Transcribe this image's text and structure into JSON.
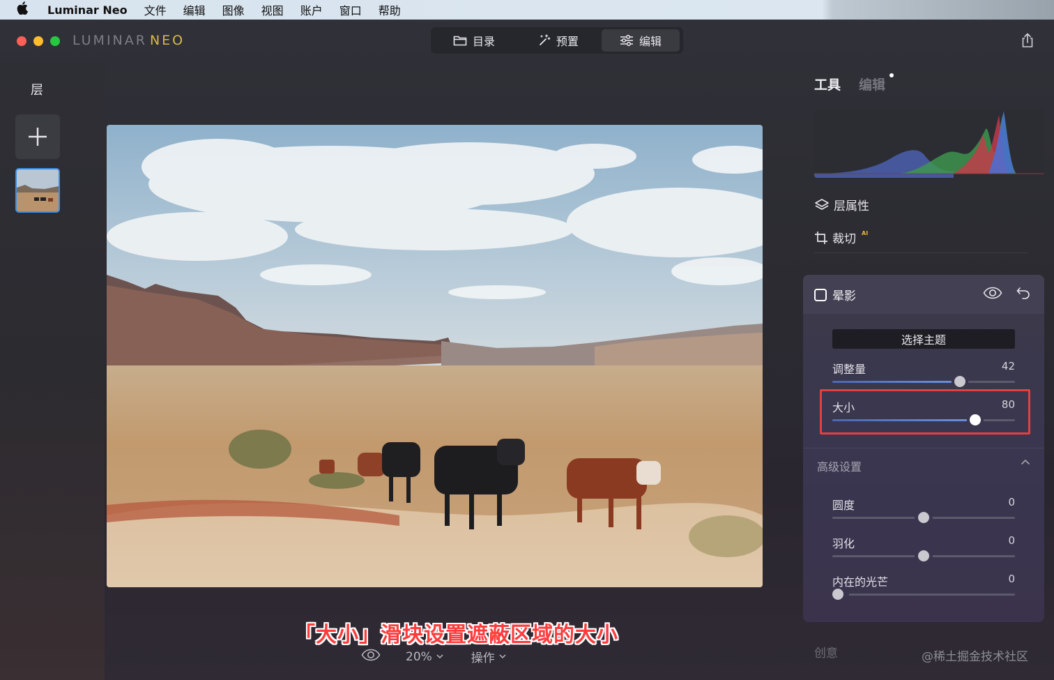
{
  "menubar": {
    "app_name": "Luminar Neo",
    "items": [
      "文件",
      "编辑",
      "图像",
      "视图",
      "账户",
      "窗口",
      "帮助"
    ]
  },
  "window": {
    "brand_main": "LUMINAR",
    "brand_accent": "NEO",
    "nav": {
      "catalog": "目录",
      "presets": "预置",
      "edit": "编辑"
    }
  },
  "layers": {
    "title": "层"
  },
  "canvas": {
    "caption": "「大小」滑块设置遮蔽区域的大小",
    "zoom": "20%",
    "actions": "操作"
  },
  "right_panel": {
    "tabs": {
      "tools": "工具",
      "edits": "编辑"
    },
    "layer_properties": "层属性",
    "crop": "裁切",
    "crop_badge": "AI",
    "vignette": {
      "title": "晕影",
      "select_subject": "选择主题",
      "sliders": {
        "amount": {
          "label": "调整量",
          "value": "42"
        },
        "size": {
          "label": "大小",
          "value": "80"
        }
      },
      "advanced": {
        "title": "高级设置",
        "roundness": {
          "label": "圆度",
          "value": "0"
        },
        "feather": {
          "label": "羽化",
          "value": "0"
        },
        "inner_light": {
          "label": "内在的光芒",
          "value": "0"
        }
      }
    },
    "creative": "创意"
  },
  "watermark": "@稀土掘金技术社区",
  "colors": {
    "accent_blue": "#3d8fe8",
    "highlight_red": "#e53f3f",
    "brand_gold": "#d9b94a"
  }
}
